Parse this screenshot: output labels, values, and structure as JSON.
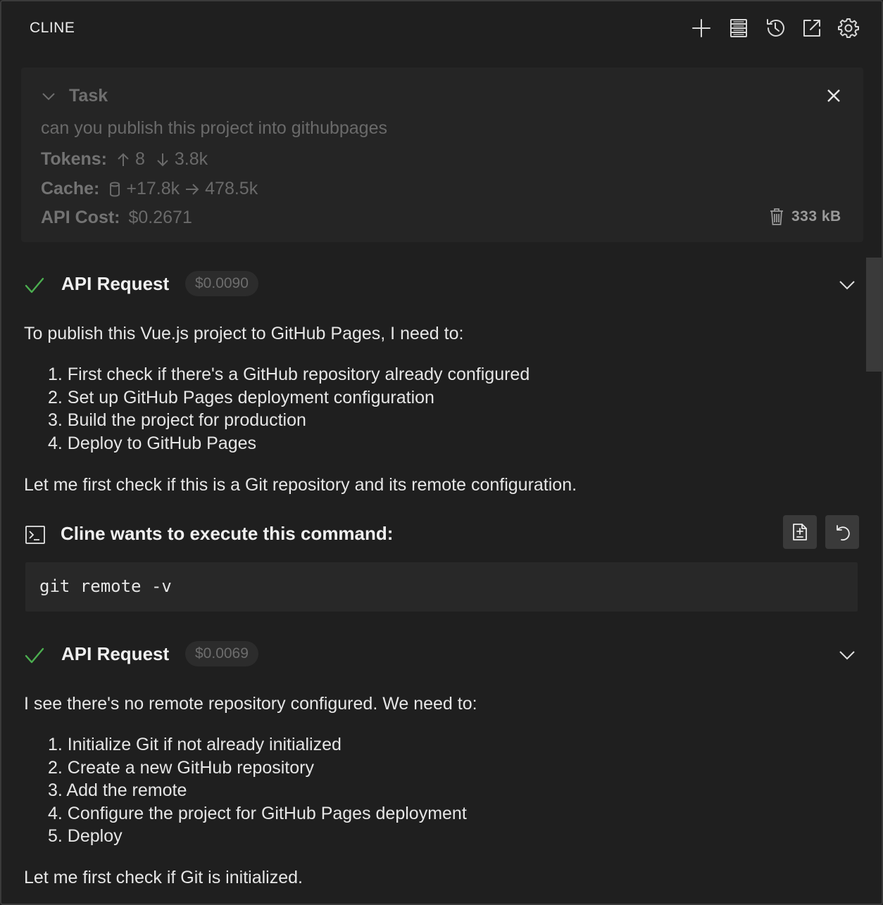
{
  "header": {
    "title": "CLINE",
    "buttons": [
      "plus-icon",
      "server-icon",
      "history-icon",
      "popout-icon",
      "settings-gear-icon"
    ]
  },
  "task": {
    "label": "Task",
    "description": "can you publish this project into githubpages",
    "tokens_label": "Tokens:",
    "tokens_in": "8",
    "tokens_out": "3.8k",
    "cache_label": "Cache:",
    "cache_write": "+17.8k",
    "cache_read": "478.5k",
    "cost_label": "API Cost:",
    "cost_value": "$0.2671",
    "size": "333 kB"
  },
  "messages": {
    "api1": {
      "label": "API Request",
      "cost": "$0.0090",
      "intro": "To publish this Vue.js project to GitHub Pages, I need to:",
      "steps": [
        "1. First check if there's a GitHub repository already configured",
        "2. Set up GitHub Pages deployment configuration",
        "3. Build the project for production",
        "4. Deploy to GitHub Pages"
      ],
      "outro": "Let me first check if this is a Git repository and its remote configuration."
    },
    "command": {
      "label": "Cline wants to execute this command:",
      "code": "git remote -v"
    },
    "api2": {
      "label": "API Request",
      "cost": "$0.0069",
      "intro": "I see there's no remote repository configured. We need to:",
      "steps": [
        "1. Initialize Git if not already initialized",
        "2. Create a new GitHub repository",
        "3. Add the remote",
        "4. Configure the project for GitHub Pages deployment",
        "5. Deploy"
      ],
      "outro": "Let me first check if Git is initialized."
    }
  },
  "colors": {
    "background": "#1f1f1f",
    "panel": "#252525",
    "success": "#4caf50",
    "text": "#e6e6e6",
    "muted": "#6a6a6a"
  }
}
